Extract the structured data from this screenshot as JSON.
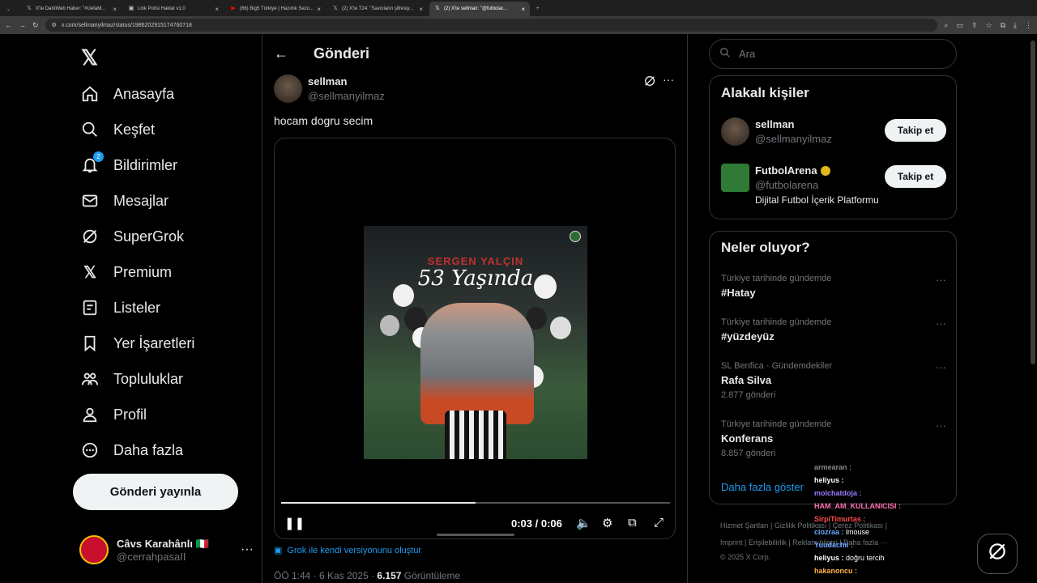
{
  "browser": {
    "tabs": [
      {
        "icon": "𝕏",
        "title": "X'te DarkWeb Haber: \"#UefaM...",
        "active": false
      },
      {
        "icon": "▣",
        "title": "Link Polisi Haklat v1.0",
        "active": false
      },
      {
        "icon": "▶",
        "title": "(66) Big5 Türkiye | Hazırlık Sezo...",
        "active": false
      },
      {
        "icon": "𝕏",
        "title": "(2) X'te T24: \"Savcıların şifresiy...",
        "active": false
      },
      {
        "icon": "𝕏",
        "title": "(2) X'te sellman: \"@futbolar...",
        "active": true
      }
    ],
    "url": "x.com/sellmanyilmaz/status/1986202915174760718"
  },
  "nav": {
    "items": [
      {
        "label": "Anasayfa",
        "icon": "home-icon"
      },
      {
        "label": "Keşfet",
        "icon": "search-icon"
      },
      {
        "label": "Bildirimler",
        "icon": "bell-icon",
        "badge": "2"
      },
      {
        "label": "Mesajlar",
        "icon": "mail-icon"
      },
      {
        "label": "SuperGrok",
        "icon": "grok-icon"
      },
      {
        "label": "Premium",
        "icon": "x-icon"
      },
      {
        "label": "Listeler",
        "icon": "list-icon"
      },
      {
        "label": "Yer İşaretleri",
        "icon": "bookmark-icon"
      },
      {
        "label": "Topluluklar",
        "icon": "communities-icon"
      },
      {
        "label": "Profil",
        "icon": "profile-icon"
      },
      {
        "label": "Daha fazla",
        "icon": "more-circle-icon"
      }
    ],
    "post_button": "Gönderi yayınla",
    "account": {
      "name": "Câvs Karahânlı 🇮🇹",
      "handle": "@cerrahpasaII"
    }
  },
  "post": {
    "header_title": "Gönderi",
    "author_name": "sellman",
    "author_handle": "@sellmanyilmaz",
    "text": "hocam dogru secim",
    "video": {
      "overlay_title": "SERGEN YALÇIN",
      "overlay_age": "53 Yaşında",
      "time": "0:03 / 0:06",
      "progress": 0.5
    },
    "grok_link": "Grok ile kendi versiyonunu oluştur",
    "meta_time": "ÖÖ 1:44 · 6 Kas 2025 · ",
    "meta_views": "6.157",
    "meta_views_label": " Görüntüleme"
  },
  "right": {
    "search_placeholder": "Ara",
    "related": {
      "title": "Alakalı kişiler",
      "people": [
        {
          "name": "sellman",
          "handle": "@sellmanyilmaz",
          "bio": "",
          "follow": "Takip et"
        },
        {
          "name": "FutbolArena",
          "handle": "@futbolarena",
          "bio": "Dijital Futbol İçerik Platformu",
          "follow": "Takip et"
        }
      ]
    },
    "trends": {
      "title": "Neler oluyor?",
      "items": [
        {
          "context": "Türkiye tarihinde gündemde",
          "name": "#Hatay",
          "count": ""
        },
        {
          "context": "Türkiye tarihinde gündemde",
          "name": "#yüzdeyüz",
          "count": ""
        },
        {
          "context": "SL Benfica · Gündemdekiler",
          "name": "Rafa Silva",
          "count": "2.877 gönderi"
        },
        {
          "context": "Türkiye tarihinde gündemde",
          "name": "Konferans",
          "count": "8.857 gönderi"
        }
      ],
      "show_more": "Daha fazla göster"
    },
    "footer": {
      "line1": "Hizmet Şartları | Gizlilik Politikası | Çerez Politikası |",
      "line2": "Imprint | Erişilebilirlik | Reklam bilgisi | Daha fazla ···",
      "line3": "© 2025 X Corp."
    },
    "chat": [
      {
        "user": "armearan",
        "msg": "",
        "color": "#8a8a8a"
      },
      {
        "user": "heliyus",
        "msg": "",
        "color": "#ffffff"
      },
      {
        "user": "molchatdoja",
        "msg": "",
        "color": "#9b7bff"
      },
      {
        "user": "HAM_AM_KULLANICISI",
        "msg": "",
        "color": "#ff6fb5"
      },
      {
        "user": "SirpiTimurtas",
        "msg": "",
        "color": "#ff4d4d"
      },
      {
        "user": "ciozraa",
        "msg": "lmouse",
        "color": "#6aa8ff"
      },
      {
        "user": "Yuudachii",
        "msg": "",
        "color": "#6aa8ff"
      },
      {
        "user": "heliyus",
        "msg": "doğru tercih",
        "color": "#ffffff"
      },
      {
        "user": "hakanoncu",
        "msg": "",
        "color": "#ffb347"
      }
    ]
  },
  "colors": {
    "accent": "#1d9bf0",
    "bg": "#000000",
    "border": "#2f3336",
    "muted": "#71767b"
  }
}
